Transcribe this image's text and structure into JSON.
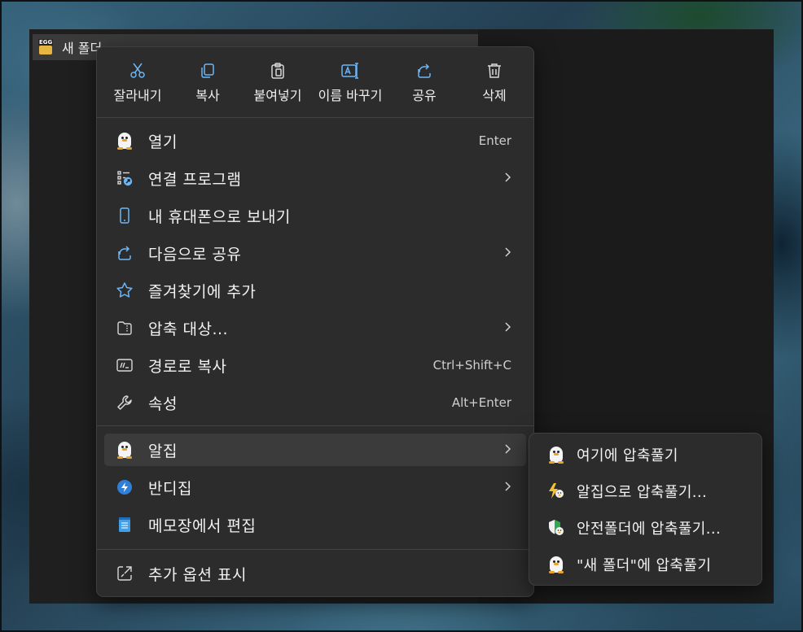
{
  "explorer": {
    "file_name": "새 폴더"
  },
  "toolbar": {
    "cut": "잘라내기",
    "copy": "복사",
    "paste": "붙여넣기",
    "rename": "이름 바꾸기",
    "share": "공유",
    "delete": "삭제"
  },
  "menu": {
    "items": [
      {
        "label": "열기",
        "shortcut": "Enter",
        "icon": "alzip-penguin-icon"
      },
      {
        "label": "연결 프로그램",
        "icon": "open-with-icon",
        "submenu": true
      },
      {
        "label": "내 휴대폰으로 보내기",
        "icon": "phone-icon"
      },
      {
        "label": "다음으로 공유",
        "icon": "share-icon",
        "submenu": true
      },
      {
        "label": "즐겨찾기에 추가",
        "icon": "star-icon"
      },
      {
        "label": "압축 대상...",
        "icon": "zip-folder-icon",
        "submenu": true
      },
      {
        "label": "경로로 복사",
        "shortcut": "Ctrl+Shift+C",
        "icon": "copy-path-icon"
      },
      {
        "label": "속성",
        "shortcut": "Alt+Enter",
        "icon": "wrench-icon"
      },
      {
        "label": "알집",
        "icon": "alzip-penguin-icon",
        "submenu": true,
        "highlighted": true
      },
      {
        "label": "반디집",
        "icon": "bandizip-icon",
        "submenu": true
      },
      {
        "label": "메모장에서 편집",
        "icon": "notepad-icon"
      },
      {
        "label": "추가 옵션 표시",
        "icon": "more-options-icon"
      }
    ]
  },
  "submenu": {
    "items": [
      {
        "label": "여기에 압축풀기",
        "icon": "alzip-penguin-icon"
      },
      {
        "label": "알집으로 압축풀기...",
        "icon": "alzip-lightning-icon"
      },
      {
        "label": "안전폴더에 압축풀기...",
        "icon": "alzip-shield-icon"
      },
      {
        "label": "\"새 폴더\"에 압축풀기",
        "icon": "alzip-penguin-icon"
      }
    ]
  },
  "colors": {
    "menu_bg": "#2c2c2c",
    "highlight": "#3b3b3b",
    "icon_blue": "#6cb6f5",
    "text": "#f2f2f2"
  }
}
